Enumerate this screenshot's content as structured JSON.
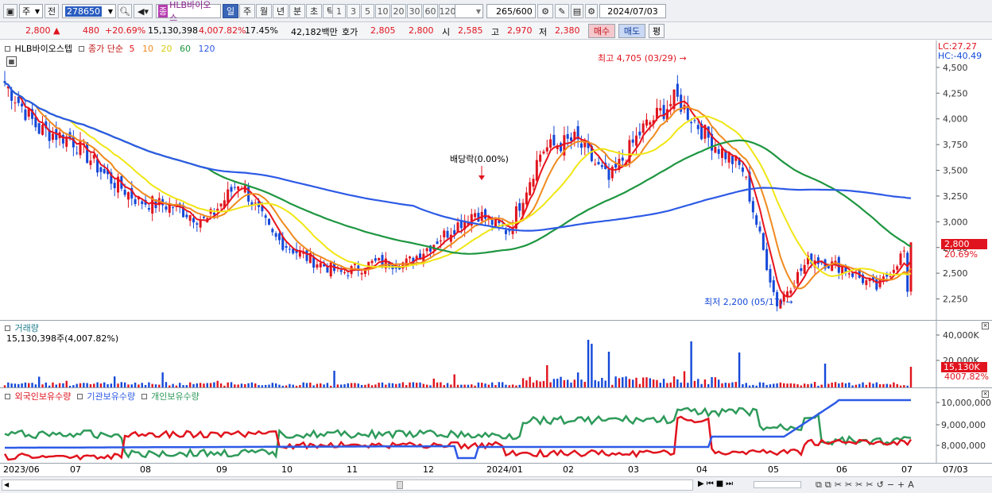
{
  "toolbar": {
    "mode_label": "주",
    "prev_label": "전",
    "code_value": "278650",
    "name_value": "HLB바이오스",
    "name_tag": "종",
    "periods": [
      "일",
      "주",
      "월",
      "년",
      "분",
      "초",
      "틱"
    ],
    "active_period": 0,
    "intervals": [
      "1",
      "3",
      "5",
      "10",
      "20",
      "30",
      "60",
      "120"
    ],
    "count_value": "265",
    "count_total": "/600",
    "date_value": "2024/07/03"
  },
  "quote": {
    "price": "2,800",
    "change": "480",
    "change_pct": "+20.69%",
    "volume": "15,130,398",
    "volume_pct": "4,007.82%",
    "turnover": "17.45%",
    "amount": "42,182백만",
    "bid_label": "호가",
    "ask": "2,805",
    "bid": "2,800",
    "open_label": "시",
    "open": "2,585",
    "high_label": "고",
    "high": "2,970",
    "low_label": "저",
    "low": "2,380",
    "buy_label": "매수",
    "sell_label": "매도",
    "eval_label": "평"
  },
  "price_panel": {
    "stock_name": "HLB바이오스텝",
    "ma_title": "종가 단순",
    "ma_periods": [
      "5",
      "10",
      "20",
      "60",
      "120"
    ],
    "lc_text": "LC:27.27",
    "hc_text": "HC:-40.49",
    "high_annot": "최고 4,705 (03/29)",
    "low_annot": "최저 2,200 (05/17)",
    "div_annot": "배당락(0.00%)",
    "last_price_tag": "2,800",
    "last_change_tag": "20.69%"
  },
  "volume_panel": {
    "title": "거래량",
    "subtitle": "15,130,398주(4,007.82%)",
    "last_tag": "15,130K",
    "pct_tag": "4007.82%"
  },
  "holding_panel": {
    "series_labels": [
      "외국인보유수량",
      "기관보유수량",
      "개인보유수량"
    ]
  },
  "x_axis_labels": [
    "2023/06",
    "07",
    "08",
    "09",
    "10",
    "11",
    "12",
    "2024/01",
    "02",
    "03",
    "04",
    "05",
    "06",
    "07",
    "07/03"
  ],
  "colors": {
    "up": "#e0141e",
    "down": "#1448d8",
    "ma5": "#e8141e",
    "ma10": "#f08a1e",
    "ma20": "#f0e614",
    "ma60": "#1e9640",
    "ma120": "#2d5ae6",
    "foreign": "#e0141e",
    "inst": "#2d5ae6",
    "indiv": "#2e9a5a"
  },
  "chart_data": [
    {
      "type": "candlestick",
      "title": "HLB바이오스텝",
      "ylim": [
        2100,
        4700
      ],
      "y_ticks": [
        "4,500",
        "4,250",
        "4,000",
        "3,750",
        "3,500",
        "3,250",
        "3,000",
        "2,750",
        "2,500",
        "2,250"
      ],
      "close_points": [
        {
          "x": "2023/06",
          "y": 4350
        },
        {
          "x": "06 mid",
          "y": 3900
        },
        {
          "x": "07",
          "y": 3800
        },
        {
          "x": "07 mid",
          "y": 3450
        },
        {
          "x": "08",
          "y": 3200
        },
        {
          "x": "08 mid",
          "y": 3150
        },
        {
          "x": "09",
          "y": 3000
        },
        {
          "x": "09 mid",
          "y": 3400
        },
        {
          "x": "10",
          "y": 2850
        },
        {
          "x": "10 mid",
          "y": 2650
        },
        {
          "x": "11",
          "y": 2500
        },
        {
          "x": "11 mid",
          "y": 2600
        },
        {
          "x": "12",
          "y": 2600
        },
        {
          "x": "12 mid",
          "y": 2850
        },
        {
          "x": "2024/01",
          "y": 3100
        },
        {
          "x": "01 mid",
          "y": 2900
        },
        {
          "x": "02",
          "y": 3700
        },
        {
          "x": "02 mid",
          "y": 3800
        },
        {
          "x": "03",
          "y": 3400
        },
        {
          "x": "03 mid",
          "y": 3900
        },
        {
          "x": "04",
          "y": 4200
        },
        {
          "x": "04 mid",
          "y": 3800
        },
        {
          "x": "05",
          "y": 3500
        },
        {
          "x": "05 mid",
          "y": 2200
        },
        {
          "x": "06",
          "y": 2650
        },
        {
          "x": "06 mid",
          "y": 2550
        },
        {
          "x": "07",
          "y": 2350
        },
        {
          "x": "07/03",
          "y": 2800
        }
      ]
    },
    {
      "type": "bar",
      "title": "거래량",
      "y_ticks": [
        "40,000K",
        "20,000K"
      ],
      "last_value": 15130398
    },
    {
      "type": "line",
      "title": "외국인보유수량 / 기관보유수량 / 개인보유수량",
      "y_ticks": [
        "10,000,000",
        "9,000,000",
        "8,000,000"
      ]
    }
  ]
}
